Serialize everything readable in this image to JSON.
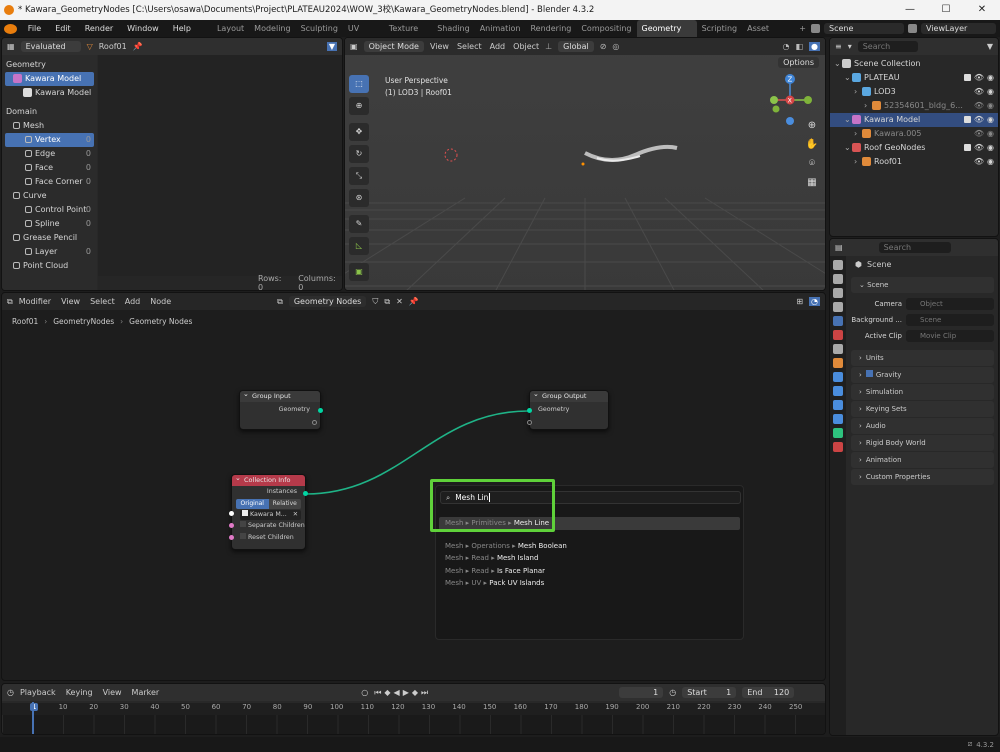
{
  "window": {
    "title": "* Kawara_GeometryNodes [C:\\Users\\osawa\\Documents\\Project\\PLATEAU2024\\WOW_3校\\Kawara_GeometryNodes.blend] - Blender 4.3.2",
    "minimize": "—",
    "maximize": "☐",
    "close": "✕"
  },
  "menu": [
    "File",
    "Edit",
    "Render",
    "Window",
    "Help"
  ],
  "workspaces": [
    "Layout",
    "Modeling",
    "Sculpting",
    "UV Editing",
    "Texture Paint",
    "Shading",
    "Animation",
    "Rendering",
    "Compositing",
    "Geometry Nodes",
    "Scripting",
    "Asset Browser",
    "+"
  ],
  "active_workspace": "Geometry Nodes",
  "scene": {
    "label": "Scene",
    "viewlayer": "ViewLayer"
  },
  "spreadsheet": {
    "mode": "Evaluated",
    "object": "Roof01",
    "geometry_label": "Geometry",
    "items": [
      {
        "label": "Kawara Model",
        "sel": true
      },
      {
        "label": "Kawara Model"
      }
    ],
    "domain_label": "Domain",
    "domains": [
      {
        "label": "Mesh",
        "group": true
      },
      {
        "label": "Vertex",
        "count": "0",
        "sel": true
      },
      {
        "label": "Edge",
        "count": "0"
      },
      {
        "label": "Face",
        "count": "0"
      },
      {
        "label": "Face Corner",
        "count": "0"
      },
      {
        "label": "Curve",
        "group": true
      },
      {
        "label": "Control Point",
        "count": "0"
      },
      {
        "label": "Spline",
        "count": "0"
      },
      {
        "label": "Grease Pencil",
        "group": true
      },
      {
        "label": "Layer",
        "count": "0"
      },
      {
        "label": "Point Cloud",
        "group": true
      }
    ],
    "rows": "Rows: 0",
    "columns": "Columns: 0"
  },
  "viewport": {
    "mode": "Object Mode",
    "menus": [
      "View",
      "Select",
      "Add",
      "Object"
    ],
    "orientation": "Global",
    "perspective": "User Perspective",
    "object_info": "(1) LOD3 | Roof01",
    "options": "Options"
  },
  "outliner": {
    "search_placeholder": "Search",
    "rows": [
      {
        "label": "Scene Collection",
        "indent": 0
      },
      {
        "label": "PLATEAU",
        "indent": 1,
        "color": "#5aa7e0"
      },
      {
        "label": "LOD3",
        "indent": 2,
        "color": "#5aa7e0"
      },
      {
        "label": "52354601_bldg_6...",
        "indent": 3,
        "color": "#e08a3a",
        "dim": true
      },
      {
        "label": "Kawara Model",
        "indent": 1,
        "color": "#c774c7",
        "sel": true
      },
      {
        "label": "Kawara.005",
        "indent": 2,
        "color": "#e08a3a",
        "dim": true
      },
      {
        "label": "Roof GeoNodes",
        "indent": 1,
        "color": "#d85454"
      },
      {
        "label": "Roof01",
        "indent": 2,
        "color": "#e08a3a"
      }
    ]
  },
  "properties": {
    "search_placeholder": "Search",
    "title": "Scene",
    "scene_section": "Scene",
    "fields": [
      {
        "label": "Camera",
        "value": "Object"
      },
      {
        "label": "Background ...",
        "value": "Scene"
      },
      {
        "label": "Active Clip",
        "value": "Movie Clip"
      }
    ],
    "sections": [
      "Units",
      "Gravity",
      "Simulation",
      "Keying Sets",
      "Audio",
      "Rigid Body World",
      "Animation",
      "Custom Properties"
    ]
  },
  "node_editor": {
    "menus": [
      "Modifier",
      "View",
      "Select",
      "Add",
      "Node"
    ],
    "tree_name": "Geometry Nodes",
    "breadcrumb": [
      "Roof01",
      "GeometryNodes",
      "Geometry Nodes"
    ],
    "group_input": {
      "title": "Group Input",
      "out": "Geometry"
    },
    "group_output": {
      "title": "Group Output",
      "in": "Geometry"
    },
    "collection_info": {
      "title": "Collection Info",
      "out": "Instances",
      "mode_a": "Original",
      "mode_b": "Relative",
      "collection": "Kawara M...",
      "separate": "Separate Children",
      "reset": "Reset Children"
    },
    "search": {
      "query": "Mesh Lin",
      "results": [
        {
          "path": "Mesh ▸ Primitives ▸ ",
          "name": "Mesh Line",
          "highlight": true
        },
        {
          "path": "Mesh ▸ Operations ▸ ",
          "name": "Mesh Boolean"
        },
        {
          "path": "Mesh ▸ Read ▸ ",
          "name": "Mesh Island"
        },
        {
          "path": "Mesh ▸ Read ▸ ",
          "name": "Is Face Planar"
        },
        {
          "path": "Mesh ▸ UV ▸ ",
          "name": "Pack UV Islands"
        }
      ]
    }
  },
  "timeline": {
    "menus": [
      "Playback",
      "Keying",
      "View",
      "Marker"
    ],
    "current": "1",
    "start_label": "Start",
    "start": "1",
    "end_label": "End",
    "end": "120",
    "ticks": [
      "1",
      "10",
      "20",
      "30",
      "40",
      "50",
      "60",
      "70",
      "80",
      "90",
      "100",
      "110",
      "120",
      "130",
      "140",
      "150",
      "160",
      "170",
      "180",
      "190",
      "200",
      "210",
      "220",
      "230",
      "240",
      "250"
    ]
  },
  "status": {
    "version": "4.3.2"
  },
  "colors": {
    "accent": "#4772b3",
    "highlight_box": "#5fd13a",
    "geometry_socket": "#00d6a3",
    "collection_header": "#b53a4a",
    "node_header": "#3a3a3a"
  }
}
